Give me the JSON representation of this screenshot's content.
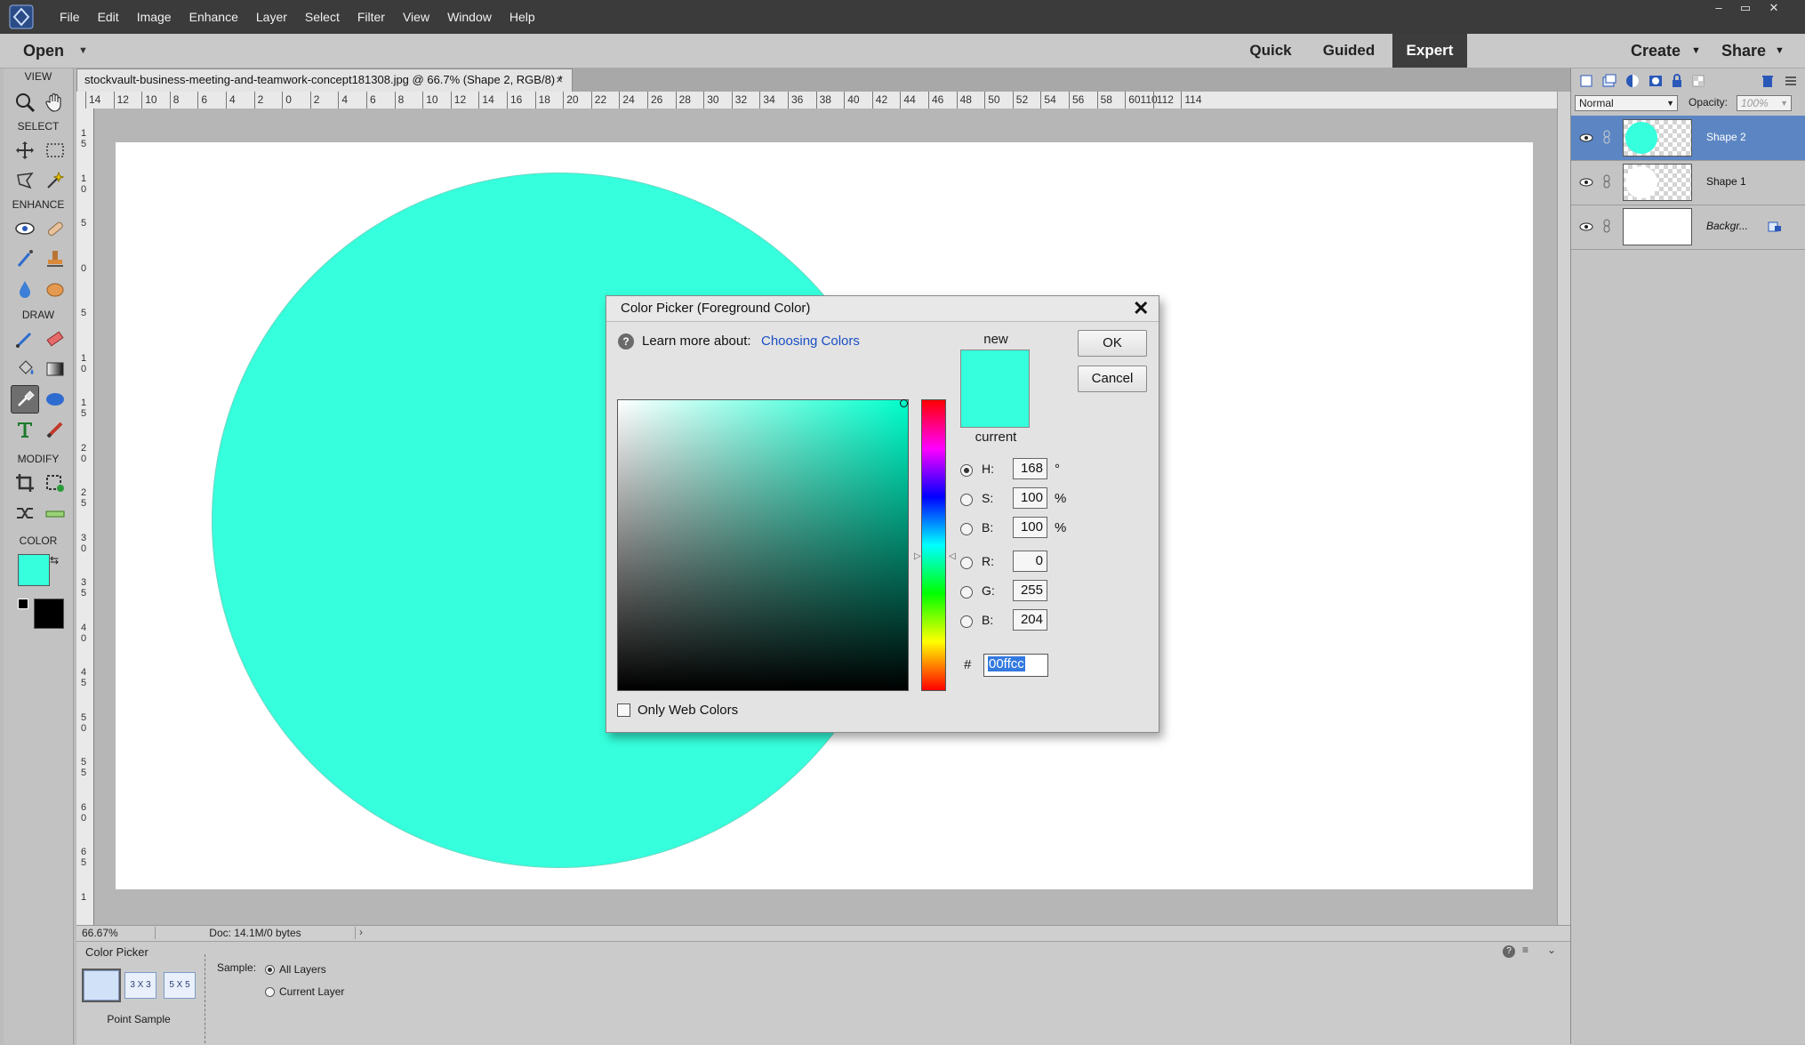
{
  "menubar": {
    "items": [
      "File",
      "Edit",
      "Image",
      "Enhance",
      "Layer",
      "Select",
      "Filter",
      "View",
      "Window",
      "Help"
    ],
    "window_controls": [
      "–",
      "▭",
      "✕"
    ]
  },
  "modebar": {
    "open_label": "Open",
    "modes": [
      "Quick",
      "Guided",
      "Expert"
    ],
    "active_mode": "Expert",
    "create_label": "Create",
    "share_label": "Share"
  },
  "toolbox": {
    "sections": [
      "VIEW",
      "SELECT",
      "ENHANCE",
      "DRAW",
      "MODIFY",
      "COLOR"
    ],
    "foreground_color": "#35ffdc",
    "background_color": "#000000"
  },
  "document": {
    "tab_title": "stockvault-business-meeting-and-teamwork-concept181308.jpg @ 66.7% (Shape 2, RGB/8) *",
    "tab_close": "×",
    "ruler_top_labels": [
      "14",
      "12",
      "10",
      "8",
      "6",
      "4",
      "2",
      "0",
      "2",
      "4",
      "6",
      "8",
      "10",
      "12",
      "14",
      "16",
      "18",
      "20",
      "22",
      "24",
      "26",
      "28",
      "30",
      "32",
      "34",
      "36",
      "38",
      "40",
      "42",
      "44",
      "46",
      "48",
      "50",
      "52",
      "54",
      "56",
      "58",
      "60110",
      "112",
      "114"
    ],
    "ruler_left_labels": [
      "1\n5",
      "1\n0",
      "5",
      "0",
      "5",
      "1\n0",
      "1\n5",
      "2\n0",
      "2\n5",
      "3\n0",
      "3\n5",
      "4\n0",
      "4\n5",
      "5\n0",
      "5\n5",
      "6\n0",
      "6\n5",
      "1"
    ],
    "circle_color": "#35ffdc"
  },
  "statusbar": {
    "zoom": "66.67%",
    "doc_size": "Doc: 14.1M/0 bytes"
  },
  "tool_options": {
    "tool_name": "Color Picker",
    "sample_sizes": [
      "3 X 3",
      "5 X 5"
    ],
    "point_sample_label": "Point Sample",
    "sample_label": "Sample:",
    "sample_options": [
      "All Layers",
      "Current Layer"
    ],
    "selected_sample": "All Layers"
  },
  "layers": {
    "blend_mode": "Normal",
    "opacity_label": "Opacity:",
    "opacity_value": "100%",
    "items": [
      {
        "name": "Shape 2",
        "active": true
      },
      {
        "name": "Shape 1",
        "active": false
      },
      {
        "name": "Backgr...",
        "active": false
      }
    ]
  },
  "color_picker": {
    "title": "Color Picker (Foreground Color)",
    "learn_more": "Learn more about:",
    "learn_link": "Choosing Colors",
    "new_label": "new",
    "current_label": "current",
    "new_color": "#35ffdc",
    "current_color": "#35ffdc",
    "ok_label": "OK",
    "cancel_label": "Cancel",
    "fields": [
      {
        "label": "H:",
        "value": "168",
        "unit": "°",
        "selected": true
      },
      {
        "label": "S:",
        "value": "100",
        "unit": "%",
        "selected": false
      },
      {
        "label": "B:",
        "value": "100",
        "unit": "%",
        "selected": false
      },
      {
        "label": "R:",
        "value": "0",
        "unit": "",
        "selected": false
      },
      {
        "label": "G:",
        "value": "255",
        "unit": "",
        "selected": false
      },
      {
        "label": "B:",
        "value": "204",
        "unit": "",
        "selected": false
      }
    ],
    "hash": "#",
    "hex_value": "00ffcc",
    "only_web_colors": "Only Web Colors",
    "help_glyph": "?",
    "close_glyph": "✕"
  }
}
